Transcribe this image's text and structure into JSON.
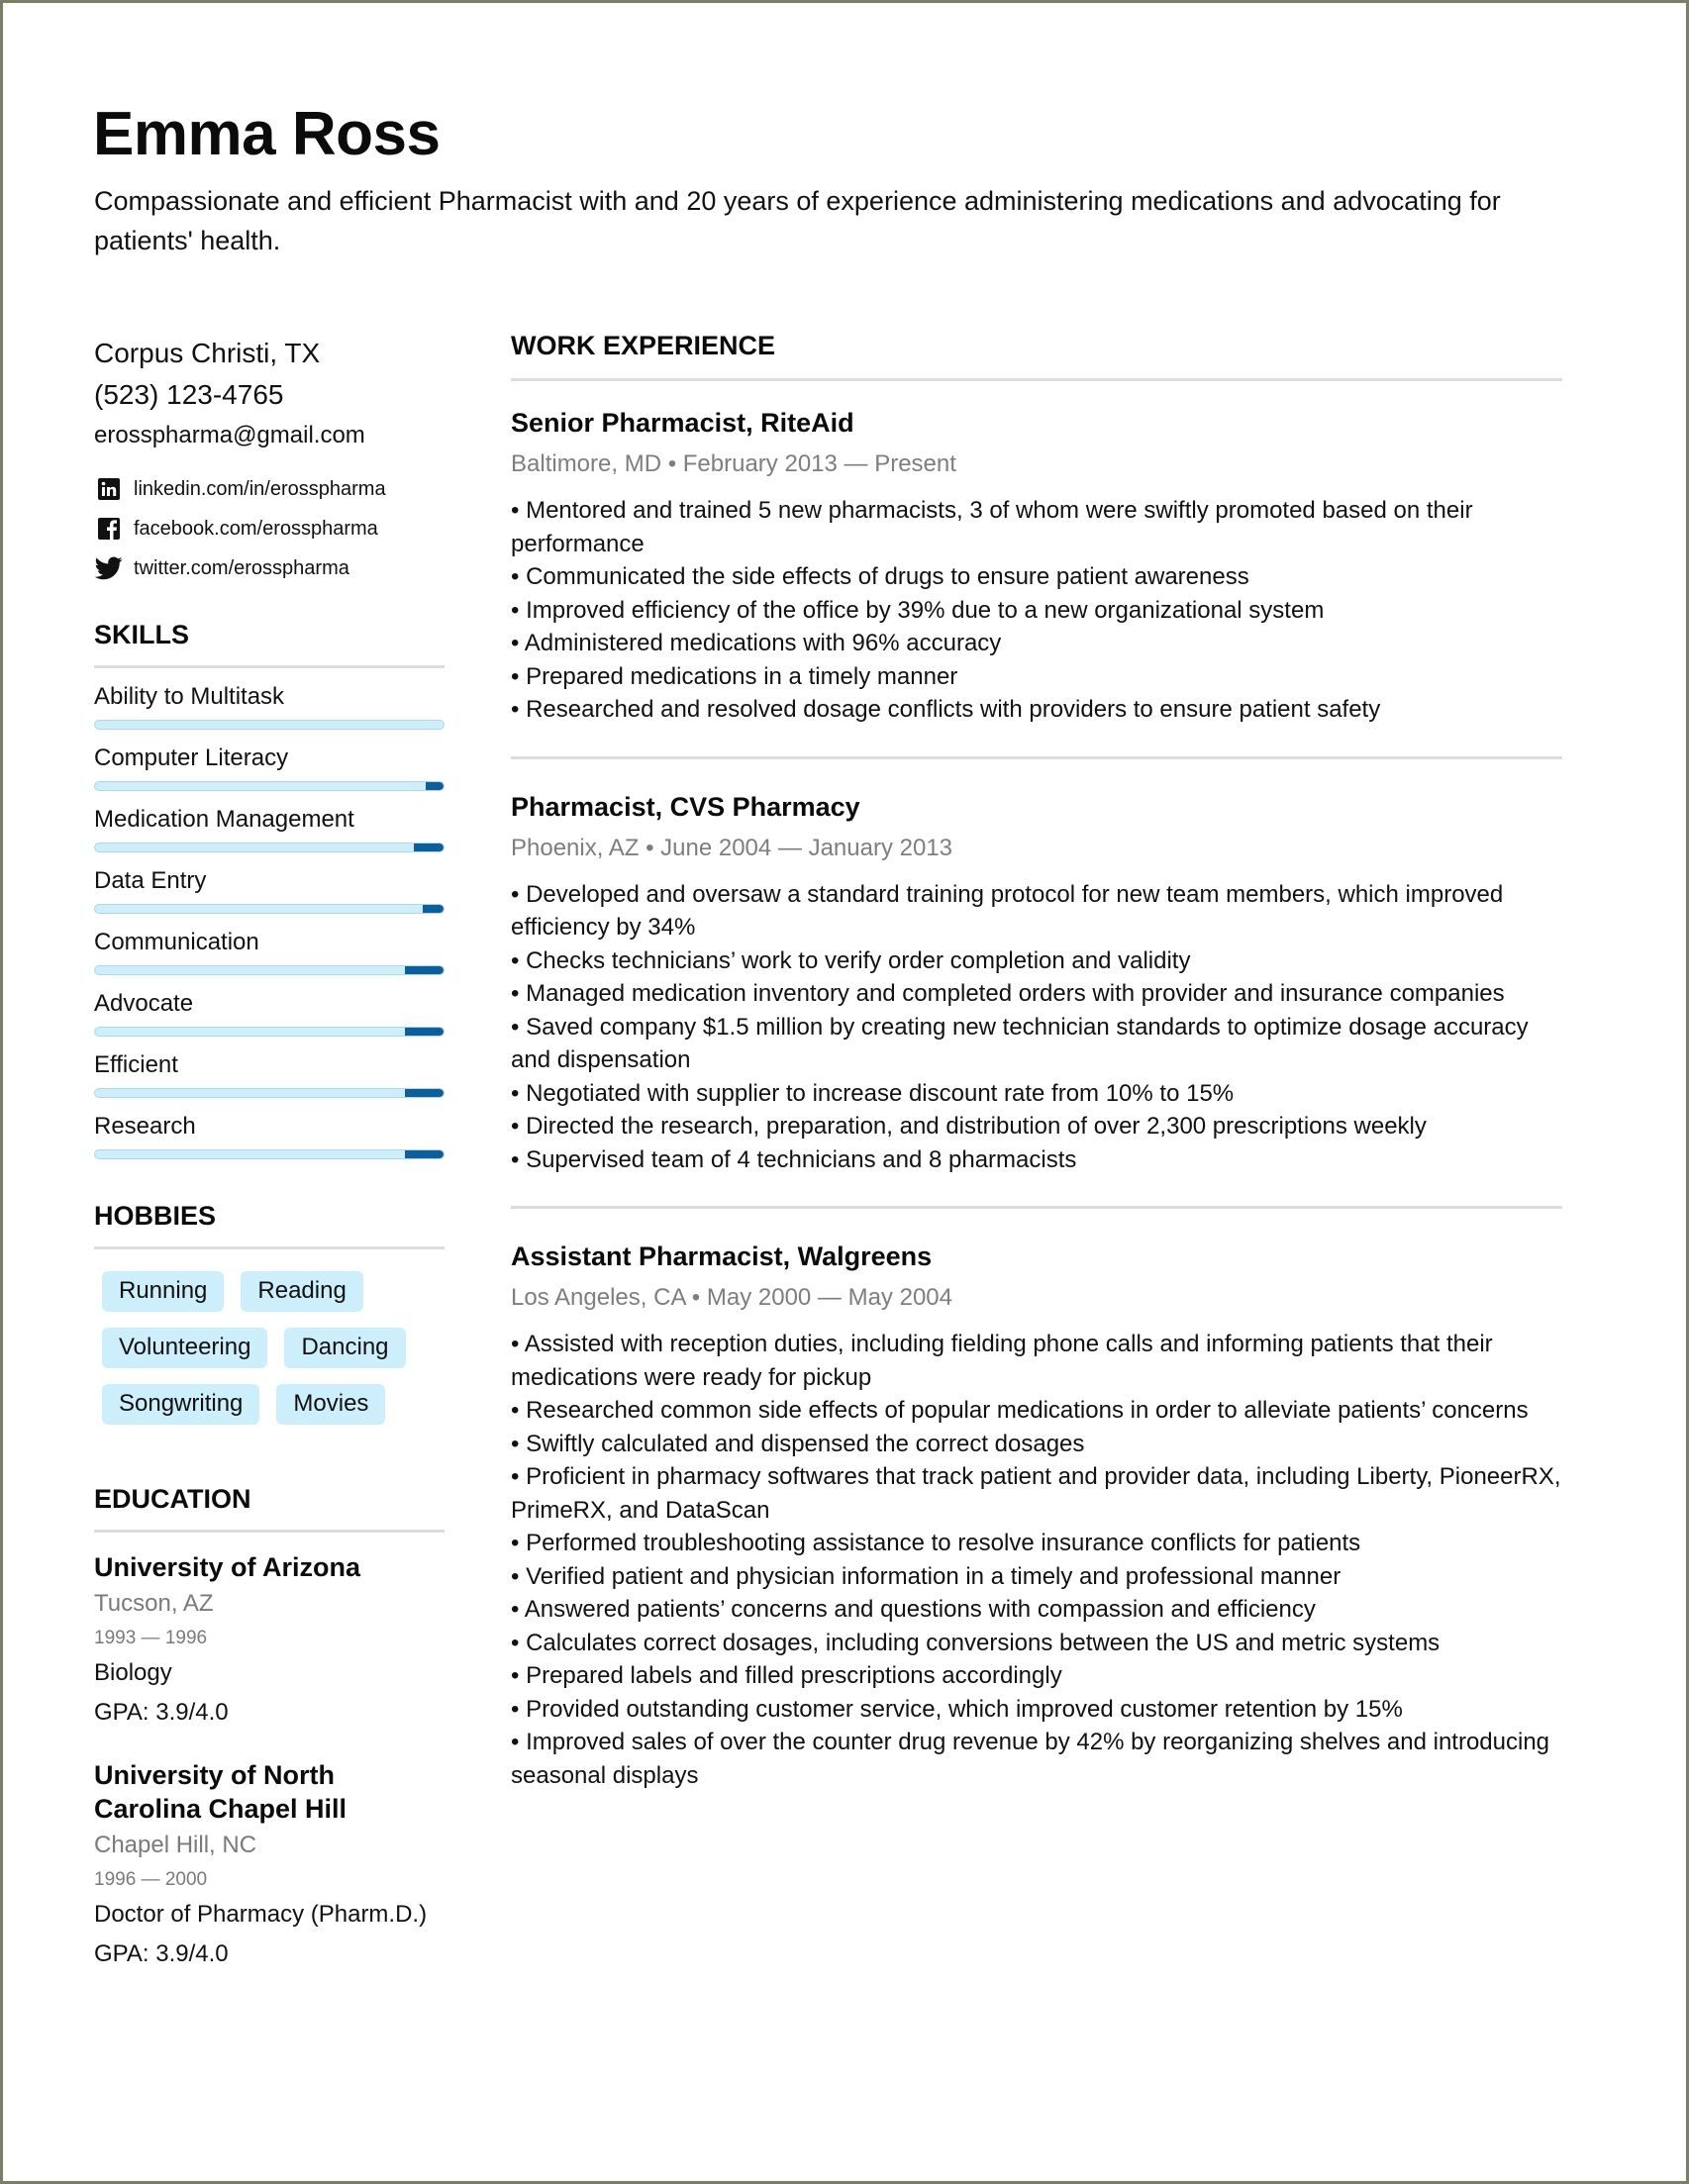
{
  "header": {
    "name": "Emma Ross",
    "summary": "Compassionate and efficient Pharmacist with and 20 years of experience administering medications and advocating for patients' health."
  },
  "contact": {
    "location": "Corpus Christi, TX",
    "phone": "(523) 123-4765",
    "email": "erosspharma@gmail.com",
    "socials": [
      {
        "icon": "linkedin-icon",
        "text": "linkedin.com/in/erosspharma"
      },
      {
        "icon": "facebook-icon",
        "text": "facebook.com/erosspharma"
      },
      {
        "icon": "twitter-icon",
        "text": "twitter.com/erosspharma"
      }
    ]
  },
  "skills": {
    "title": "SKILLS",
    "colors": {
      "track": "#cfeefb",
      "fill": "#0e5f99"
    },
    "items": [
      {
        "label": "Ability to Multitask",
        "dark_fraction": 0.0
      },
      {
        "label": "Computer Literacy",
        "dark_fraction": 0.05
      },
      {
        "label": "Medication Management",
        "dark_fraction": 0.085
      },
      {
        "label": "Data Entry",
        "dark_fraction": 0.06
      },
      {
        "label": "Communication",
        "dark_fraction": 0.11
      },
      {
        "label": "Advocate",
        "dark_fraction": 0.11
      },
      {
        "label": "Efficient",
        "dark_fraction": 0.11
      },
      {
        "label": "Research",
        "dark_fraction": 0.11
      }
    ]
  },
  "hobbies": {
    "title": "HOBBIES",
    "items": [
      "Running",
      "Reading",
      "Volunteering",
      "Dancing",
      "Songwriting",
      "Movies"
    ]
  },
  "education": {
    "title": "EDUCATION",
    "items": [
      {
        "school": "University of Arizona",
        "location": "Tucson, AZ",
        "years": "1993 — 1996",
        "degree": "Biology",
        "gpa": "GPA: 3.9/4.0"
      },
      {
        "school": "University of North Carolina Chapel Hill",
        "location": "Chapel Hill, NC",
        "years": "1996 — 2000",
        "degree": "Doctor of Pharmacy (Pharm.D.)",
        "gpa": "GPA: 3.9/4.0"
      }
    ]
  },
  "work": {
    "title": "WORK EXPERIENCE",
    "jobs": [
      {
        "title": "Senior Pharmacist, RiteAid",
        "meta": "Baltimore, MD • February 2013 — Present",
        "bullets": [
          "• Mentored and trained 5 new pharmacists, 3 of whom were swiftly promoted based on their performance",
          "• Communicated the side effects of drugs to ensure patient awareness",
          "• Improved efficiency of the office by 39% due to a new organizational system",
          "• Administered medications with 96% accuracy",
          "• Prepared medications in a timely manner",
          "• Researched and resolved dosage conflicts with providers to ensure patient safety"
        ]
      },
      {
        "title": "Pharmacist, CVS Pharmacy",
        "meta": "Phoenix, AZ • June 2004 — January 2013",
        "bullets": [
          "• Developed and oversaw a standard training protocol for new team members, which improved efficiency by 34%",
          "• Checks technicians’ work to verify order completion and validity",
          "• Managed medication inventory and completed orders with provider and insurance companies",
          "• Saved company $1.5 million by creating new technician standards to optimize dosage accuracy and dispensation",
          "• Negotiated with supplier to increase discount rate from 10% to 15%",
          "• Directed the research, preparation, and distribution of over 2,300 prescriptions weekly",
          "• Supervised team of 4 technicians and 8 pharmacists"
        ]
      },
      {
        "title": "Assistant Pharmacist, Walgreens",
        "meta": "Los Angeles, CA • May 2000 — May 2004",
        "bullets": [
          "• Assisted with reception duties, including fielding phone calls and informing patients that their medications were ready for pickup",
          "• Researched common side effects of popular medications in order to alleviate patients’ concerns",
          "• Swiftly calculated and dispensed the correct dosages",
          "• Proficient in pharmacy softwares that track patient and provider data, including Liberty, PioneerRX, PrimeRX, and DataScan",
          "• Performed troubleshooting assistance to resolve insurance conflicts for patients",
          "• Verified patient and physician information in a timely and professional manner",
          "• Answered patients’ concerns and questions with compassion and efficiency",
          "• Calculates correct dosages, including conversions between the US and metric systems",
          "• Prepared labels and filled prescriptions accordingly",
          "• Provided outstanding customer service, which improved customer retention by 15%",
          "• Improved sales of over the counter drug revenue by 42% by reorganizing shelves and introducing seasonal displays"
        ]
      }
    ]
  }
}
